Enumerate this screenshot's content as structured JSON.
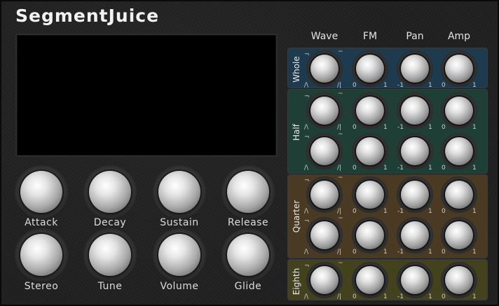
{
  "app": {
    "title": "SegmentJuice"
  },
  "main_knobs": [
    {
      "label": "Attack"
    },
    {
      "label": "Decay"
    },
    {
      "label": "Sustain"
    },
    {
      "label": "Release"
    },
    {
      "label": "Stereo"
    },
    {
      "label": "Tune"
    },
    {
      "label": "Volume"
    },
    {
      "label": "Glide"
    }
  ],
  "columns": [
    "Wave",
    "FM",
    "Pan",
    "Amp"
  ],
  "ranges": {
    "wave": {
      "left": "/\\",
      "right": "/|",
      "top_left": "¬",
      "top_right": "~"
    },
    "fm": {
      "min": "0",
      "max": "1"
    },
    "pan": {
      "min": "-1",
      "max": "1"
    },
    "amp": {
      "min": "0",
      "max": "1"
    }
  },
  "sections": [
    {
      "label": "Whole",
      "rows": 1,
      "color": "#1e3a4e"
    },
    {
      "label": "Half",
      "rows": 2,
      "color": "#1f3f36"
    },
    {
      "label": "Quarter",
      "rows": 2,
      "color": "#4a3a24"
    },
    {
      "label": "Eighth",
      "rows": 1,
      "color": "#44421e"
    }
  ]
}
